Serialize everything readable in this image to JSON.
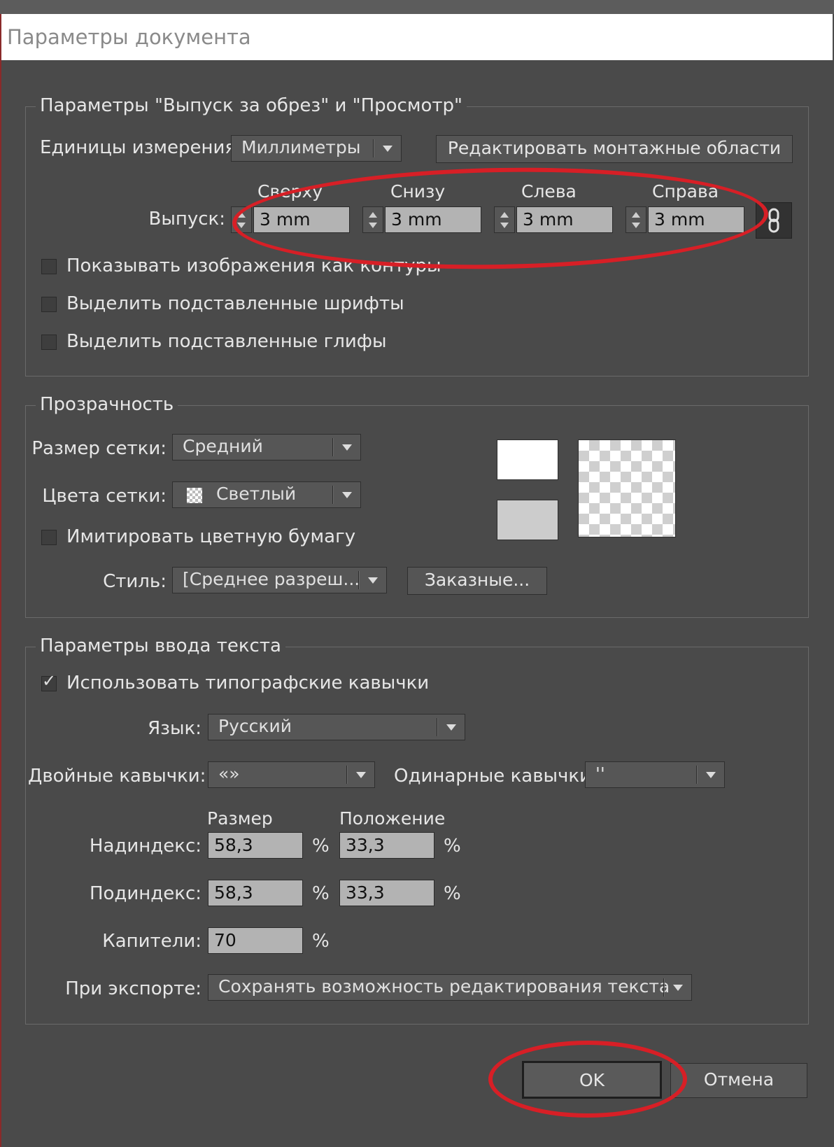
{
  "window": {
    "title": "Параметры документа"
  },
  "bleed_view": {
    "legend": "Параметры \"Выпуск за обрез\" и \"Просмотр\"",
    "units_label": "Единицы измерения:",
    "units_value": "Миллиметры",
    "edit_artboards_button": "Редактировать монтажные области",
    "bleed_label": "Выпуск:",
    "bleed_fields": [
      {
        "header": "Сверху",
        "value": "3 mm"
      },
      {
        "header": "Снизу",
        "value": "3 mm"
      },
      {
        "header": "Слева",
        "value": "3 mm"
      },
      {
        "header": "Справа",
        "value": "3 mm"
      }
    ],
    "link_icon": "chain-link-icon",
    "checkboxes": [
      {
        "label": "Показывать изображения как контуры",
        "checked": false
      },
      {
        "label": "Выделить подставленные шрифты",
        "checked": false
      },
      {
        "label": "Выделить подставленные глифы",
        "checked": false
      }
    ]
  },
  "transparency": {
    "legend": "Прозрачность",
    "grid_size_label": "Размер сетки:",
    "grid_size_value": "Средний",
    "grid_colors_label": "Цвета сетки:",
    "grid_colors_value": "Светлый",
    "simulate_paper_label": "Имитировать цветную бумагу",
    "simulate_paper_checked": false,
    "style_label": "Стиль:",
    "style_value": "[Среднее разреш...",
    "custom_button": "Заказные..."
  },
  "text_options": {
    "legend": "Параметры ввода текста",
    "typographic_quotes_label": "Использовать типографские кавычки",
    "typographic_quotes_checked": true,
    "language_label": "Язык:",
    "language_value": "Русский",
    "double_quotes_label": "Двойные кавычки:",
    "double_quotes_value": "«»",
    "single_quotes_label": "Одинарные кавычки:",
    "single_quotes_value": "''",
    "size_header": "Размер",
    "position_header": "Положение",
    "superscript_label": "Надиндекс:",
    "superscript_size": "58,3",
    "superscript_position": "33,3",
    "subscript_label": "Подиндекс:",
    "subscript_size": "58,3",
    "subscript_position": "33,3",
    "smallcaps_label": "Капители:",
    "smallcaps_value": "70",
    "percent": "%",
    "export_label": "При экспорте:",
    "export_value": "Сохранять возможность редактирования текста"
  },
  "buttons": {
    "ok": "OK",
    "cancel": "Отмена"
  },
  "colors": {
    "annotation": "#d71f26",
    "dialog_bg": "#4a4a4a"
  }
}
